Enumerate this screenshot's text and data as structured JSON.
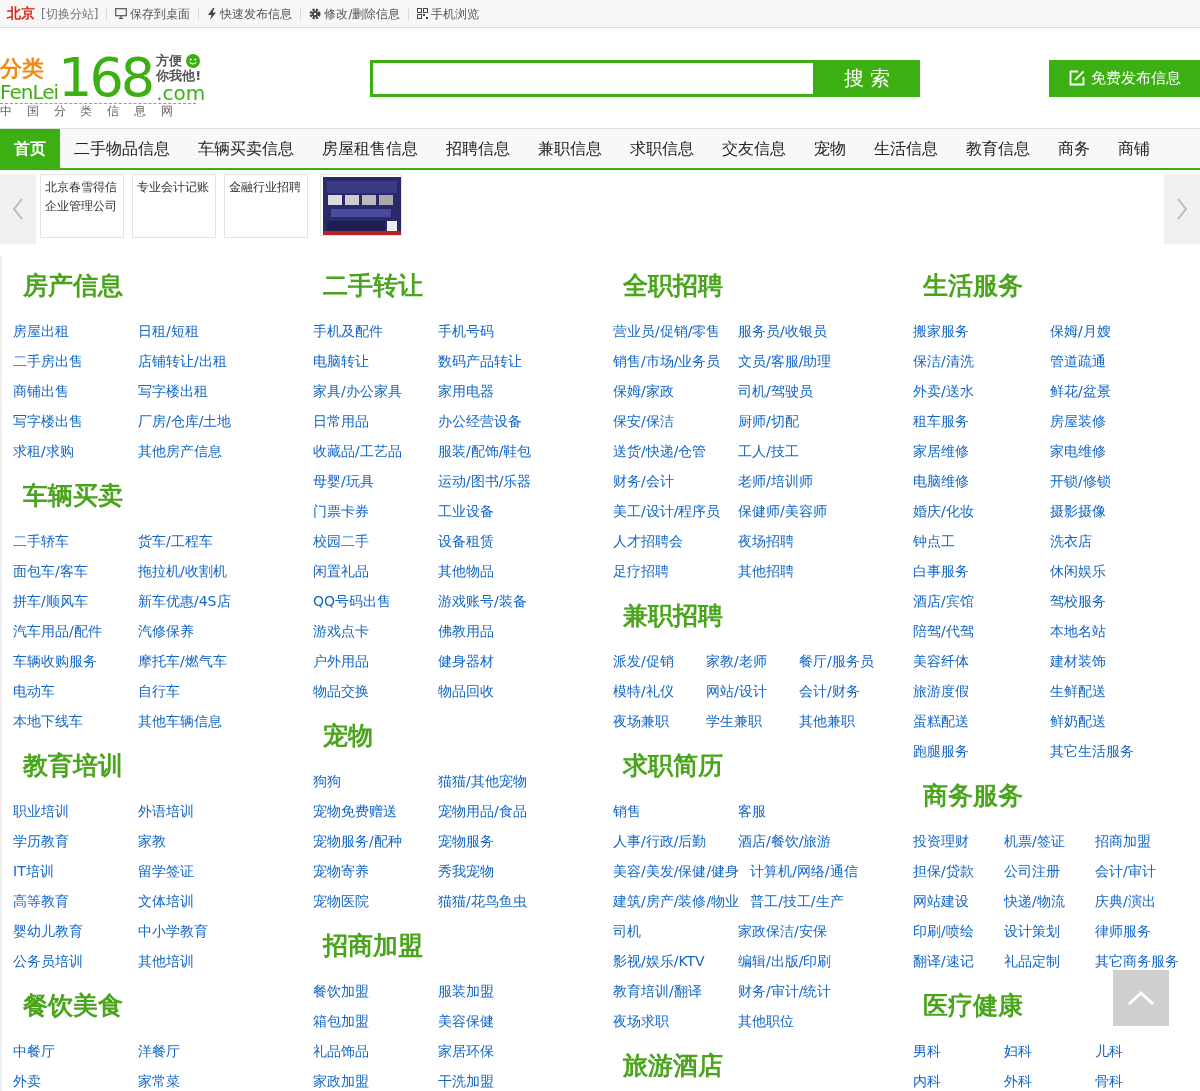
{
  "topbar": [
    {
      "kind": "city",
      "text": "北京"
    },
    {
      "kind": "switch",
      "text": "[切换分站]"
    },
    {
      "kind": "link",
      "text": "保存到桌面"
    },
    {
      "kind": "link",
      "text": "快速发布信息"
    },
    {
      "kind": "link",
      "text": "修改/删除信息"
    },
    {
      "kind": "link",
      "text": "手机浏览"
    }
  ],
  "logo": {
    "cn": "分类",
    "en": "FenLei",
    "num": "168",
    "slogan": [
      "方便",
      "你我他!"
    ],
    "domain": ".com",
    "tagline": "中 国 分 类 信 息 网"
  },
  "search": {
    "button": "搜 索"
  },
  "publish": {
    "button": "免费发布信息"
  },
  "nav": [
    {
      "label": "首页",
      "selected": true
    },
    {
      "label": "二手物品信息",
      "selected": false
    },
    {
      "label": "车辆买卖信息",
      "selected": false
    },
    {
      "label": "房屋租售信息",
      "selected": false
    },
    {
      "label": "招聘信息",
      "selected": false
    },
    {
      "label": "兼职信息",
      "selected": false
    },
    {
      "label": "求职信息",
      "selected": false
    },
    {
      "label": "交友信息",
      "selected": false
    },
    {
      "label": "宠物",
      "selected": false
    },
    {
      "label": "生活信息",
      "selected": false
    },
    {
      "label": "教育信息",
      "selected": false
    },
    {
      "label": "商务",
      "selected": false
    },
    {
      "label": "商铺",
      "selected": false
    }
  ],
  "carousel": [
    {
      "kind": "text",
      "text": "北京春雪得信企业管理公司"
    },
    {
      "kind": "text",
      "text": "专业会计记账"
    },
    {
      "kind": "text",
      "text": "金融行业招聘"
    },
    {
      "kind": "picture"
    }
  ],
  "columns": [
    [
      {
        "title": "房产信息",
        "rows": [
          [
            "房屋出租",
            "日租/短租"
          ],
          [
            "二手房出售",
            "店铺转让/出租"
          ],
          [
            "商铺出售",
            "写字楼出租"
          ],
          [
            "写字楼出售",
            "厂房/仓库/土地"
          ],
          [
            "求租/求购",
            "其他房产信息"
          ]
        ]
      },
      {
        "title": "车辆买卖",
        "rows": [
          [
            "二手轿车",
            "货车/工程车"
          ],
          [
            "面包车/客车",
            "拖拉机/收割机"
          ],
          [
            "拼车/顺风车",
            "新车优惠/4S店"
          ],
          [
            "汽车用品/配件",
            "汽修保养"
          ],
          [
            "车辆收购服务",
            "摩托车/燃气车"
          ],
          [
            "电动车",
            "自行车"
          ],
          [
            "本地下线车",
            "其他车辆信息"
          ]
        ]
      },
      {
        "title": "教育培训",
        "rows": [
          [
            "职业培训",
            "外语培训"
          ],
          [
            "学历教育",
            "家教"
          ],
          [
            "IT培训",
            "留学签证"
          ],
          [
            "高等教育",
            "文体培训"
          ],
          [
            "婴幼儿教育",
            "中小学教育"
          ],
          [
            "公务员培训",
            "其他培训"
          ]
        ]
      },
      {
        "title": "餐饮美食",
        "rows": [
          [
            "中餐厅",
            "洋餐厅"
          ],
          [
            "外卖",
            "家常菜"
          ]
        ]
      }
    ],
    [
      {
        "title": "二手转让",
        "rows": [
          [
            "手机及配件",
            "手机号码"
          ],
          [
            "电脑转让",
            "数码产品转让"
          ],
          [
            "家具/办公家具",
            "家用电器"
          ],
          [
            "日常用品",
            "办公经营设备"
          ],
          [
            "收藏品/工艺品",
            "服装/配饰/鞋包"
          ],
          [
            "母婴/玩具",
            "运动/图书/乐器"
          ],
          [
            "门票卡券",
            "工业设备"
          ],
          [
            "校园二手",
            "设备租赁"
          ],
          [
            "闲置礼品",
            "其他物品"
          ],
          [
            "QQ号码出售",
            "游戏账号/装备"
          ],
          [
            "游戏点卡",
            "佛教用品"
          ],
          [
            "户外用品",
            "健身器材"
          ],
          [
            "物品交换",
            "物品回收"
          ]
        ]
      },
      {
        "title": "宠物",
        "rows": [
          [
            "狗狗",
            "猫猫/其他宠物"
          ],
          [
            "宠物免费赠送",
            "宠物用品/食品"
          ],
          [
            "宠物服务/配种",
            "宠物服务"
          ],
          [
            "宠物寄养",
            "秀我宠物"
          ],
          [
            "宠物医院",
            "猫猫/花鸟鱼虫"
          ]
        ]
      },
      {
        "title": "招商加盟",
        "rows": [
          [
            "餐饮加盟",
            "服装加盟"
          ],
          [
            "箱包加盟",
            "美容保健"
          ],
          [
            "礼品饰品",
            "家居环保"
          ],
          [
            "家政加盟",
            "干洗加盟"
          ]
        ]
      }
    ],
    [
      {
        "title": "全职招聘",
        "rows": [
          [
            "营业员/促销/零售",
            "服务员/收银员"
          ],
          [
            "销售/市场/业务员",
            "文员/客服/助理"
          ],
          [
            "保姆/家政",
            "司机/驾驶员"
          ],
          [
            "保安/保洁",
            "厨师/切配"
          ],
          [
            "送货/快递/仓管",
            "工人/技工"
          ],
          [
            "财务/会计",
            "老师/培训师"
          ],
          [
            "美工/设计/程序员",
            "保健师/美容师"
          ],
          [
            "人才招聘会",
            "夜场招聘"
          ],
          [
            "足疗招聘",
            "其他招聘"
          ]
        ]
      },
      {
        "title": "兼职招聘",
        "rows": [
          [
            "派发/促销",
            "家教/老师",
            "餐厅/服务员"
          ],
          [
            "模特/礼仪",
            "网站/设计",
            "会计/财务"
          ],
          [
            "夜场兼职",
            "学生兼职",
            "其他兼职"
          ]
        ]
      },
      {
        "title": "求职简历",
        "rows": [
          [
            "销售",
            "客服"
          ],
          [
            "人事/行政/后勤",
            "酒店/餐饮/旅游"
          ],
          [
            "美容/美发/保健/健身",
            "计算机/网络/通信"
          ],
          [
            "建筑/房产/装修/物业",
            "普工/技工/生产"
          ],
          [
            "司机",
            "家政保洁/安保"
          ],
          [
            "影视/娱乐/KTV",
            "编辑/出版/印刷"
          ],
          [
            "教育培训/翻译",
            "财务/审计/统计"
          ],
          [
            "夜场求职",
            "其他职位"
          ]
        ]
      },
      {
        "title": "旅游酒店"
      }
    ],
    [
      {
        "title": "生活服务",
        "rows": [
          [
            "搬家服务",
            "保姆/月嫂"
          ],
          [
            "保洁/清洗",
            "管道疏通"
          ],
          [
            "外卖/送水",
            "鲜花/盆景"
          ],
          [
            "租车服务",
            "房屋装修"
          ],
          [
            "家居维修",
            "家电维修"
          ],
          [
            "电脑维修",
            "开锁/修锁"
          ],
          [
            "婚庆/化妆",
            "摄影摄像"
          ],
          [
            "钟点工",
            "洗衣店"
          ],
          [
            "白事服务",
            "休闲娱乐"
          ],
          [
            "酒店/宾馆",
            "驾校服务"
          ],
          [
            "陪驾/代驾",
            "本地名站"
          ],
          [
            "美容纤体",
            "建材装饰"
          ],
          [
            "旅游度假",
            "生鲜配送"
          ],
          [
            "蛋糕配送",
            "鲜奶配送"
          ],
          [
            "跑腿服务",
            "其它生活服务"
          ]
        ]
      },
      {
        "title": "商务服务",
        "rows": [
          [
            "投资理财",
            "机票/签证",
            "招商加盟"
          ],
          [
            "担保/贷款",
            "公司注册",
            "会计/审计"
          ],
          [
            "网站建设",
            "快递/物流",
            "庆典/演出"
          ],
          [
            "印刷/喷绘",
            "设计策划",
            "律师服务"
          ],
          [
            "翻译/速记",
            "礼品定制",
            "其它商务服务"
          ]
        ]
      },
      {
        "title": "医疗健康",
        "rows": [
          [
            "男科",
            "妇科",
            "儿科"
          ],
          [
            "内科",
            "外科",
            "骨科"
          ]
        ]
      }
    ]
  ]
}
